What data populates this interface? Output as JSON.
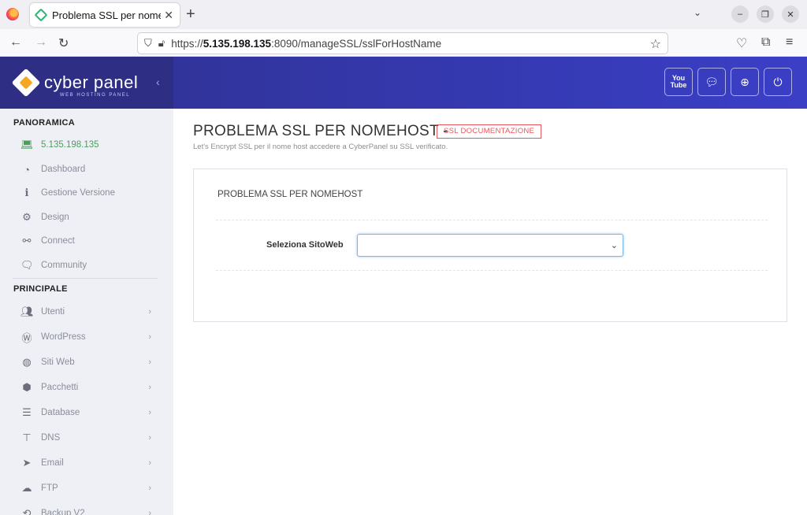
{
  "browser": {
    "tab_title": "Problema SSL per nomeh",
    "url_prefix": "https://",
    "url_host": "5.135.198.135",
    "url_rest": ":8090/manageSSL/sslForHostName"
  },
  "header": {
    "logo_text": "cyber panel",
    "logo_sub": "WEB HOSTING PANEL",
    "buttons": [
      "youtube-icon",
      "chat-icon",
      "support-icon",
      "power-icon"
    ]
  },
  "sidebar": {
    "section1": "PANORAMICA",
    "section2": "PRINCIPALE",
    "overview_items": [
      {
        "label": "5.135.198.135",
        "icon": "laptop-icon"
      },
      {
        "label": "Dashboard",
        "icon": "dashboard-icon"
      },
      {
        "label": "Gestione Versione",
        "icon": "info-icon"
      },
      {
        "label": "Design",
        "icon": "gear-icon"
      },
      {
        "label": "Connect",
        "icon": "link-icon"
      },
      {
        "label": "Community",
        "icon": "comments-icon"
      }
    ],
    "main_items": [
      {
        "label": "Utenti",
        "icon": "users-icon"
      },
      {
        "label": "WordPress",
        "icon": "wordpress-icon"
      },
      {
        "label": "Siti Web",
        "icon": "globe-icon"
      },
      {
        "label": "Pacchetti",
        "icon": "cubes-icon"
      },
      {
        "label": "Database",
        "icon": "database-icon"
      },
      {
        "label": "DNS",
        "icon": "sitemap-icon"
      },
      {
        "label": "Email",
        "icon": "paper-plane-icon"
      },
      {
        "label": "FTP",
        "icon": "cloud-upload-icon"
      },
      {
        "label": "Backup V2",
        "icon": "backup-icon"
      }
    ]
  },
  "main": {
    "title": "PROBLEMA SSL PER NOMEHOST -",
    "doc_badge": "SSL DOCUMENTAZIONE",
    "subtitle": "Let's Encrypt SSL per il nome host accedere a CyberPanel su SSL verificato.",
    "card_title": "PROBLEMA SSL PER NOMEHOST",
    "field_label": "Seleziona SitoWeb",
    "select_value": ""
  }
}
